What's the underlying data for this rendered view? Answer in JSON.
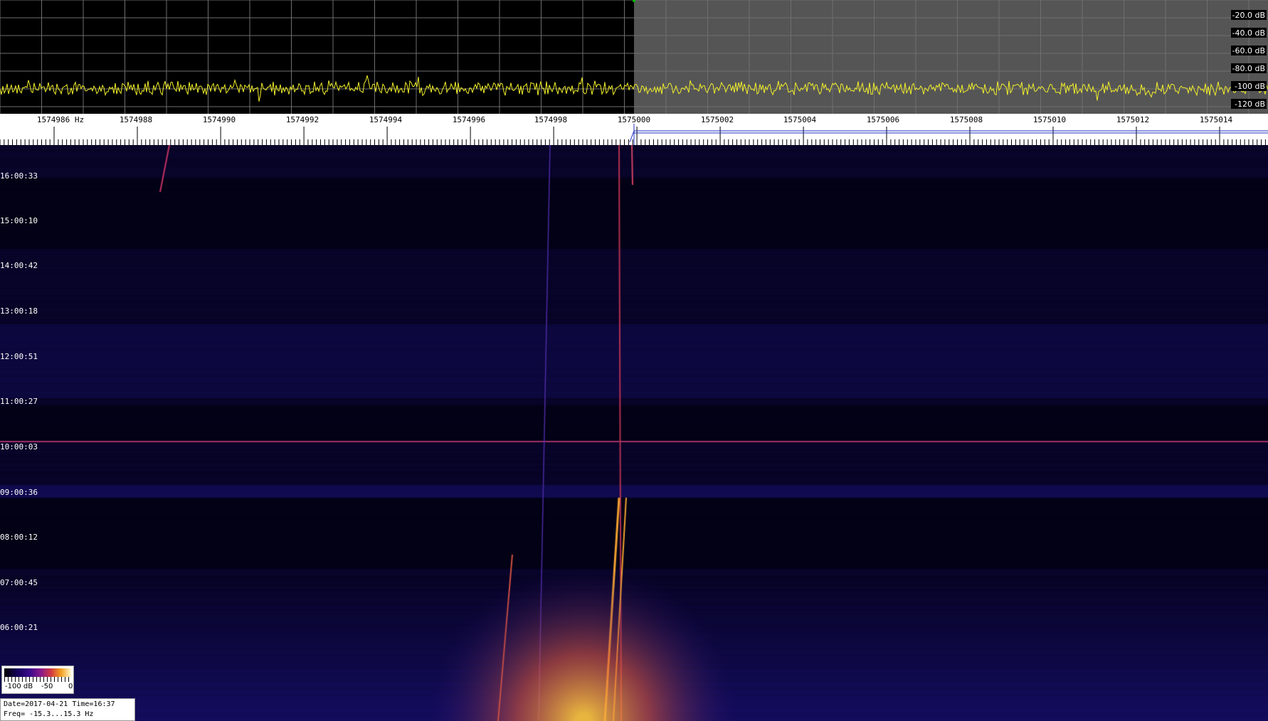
{
  "spectrum": {
    "db_labels": [
      "-20.0 dB",
      "-40.0 dB",
      "-60.0 dB",
      "-80.0 dB",
      "-100 dB",
      "-120 dB"
    ],
    "colors": {
      "background_left": "#000000",
      "background_right": "#555555",
      "trace": "#f2f02a",
      "grid": "#6e6e6e"
    }
  },
  "frequency_axis": {
    "labels": [
      "1574986 Hz",
      "1574988",
      "1574990",
      "1574992",
      "1574994",
      "1574996",
      "1574998",
      "1575000",
      "1575002",
      "1575004",
      "1575006",
      "1575008",
      "1575010",
      "1575012",
      "1575014"
    ]
  },
  "waterfall": {
    "time_labels": [
      "16:00:33",
      "15:00:10",
      "14:00:42",
      "13:00:18",
      "12:00:51",
      "11:00:27",
      "10:00:03",
      "09:00:36",
      "08:00:12",
      "07:00:45",
      "06:00:21"
    ],
    "colormap": [
      "#000000",
      "#14005a",
      "#3a0a8a",
      "#8a1a8a",
      "#d23a40",
      "#f3a020",
      "#fff8d0"
    ]
  },
  "colorbar": {
    "labels": [
      "-100 dB",
      "-50",
      "0"
    ]
  },
  "info": {
    "date_line": "Date=2017-04-21 Time=16:37",
    "freq_line": "Freq= -15.3...15.3 Hz"
  }
}
